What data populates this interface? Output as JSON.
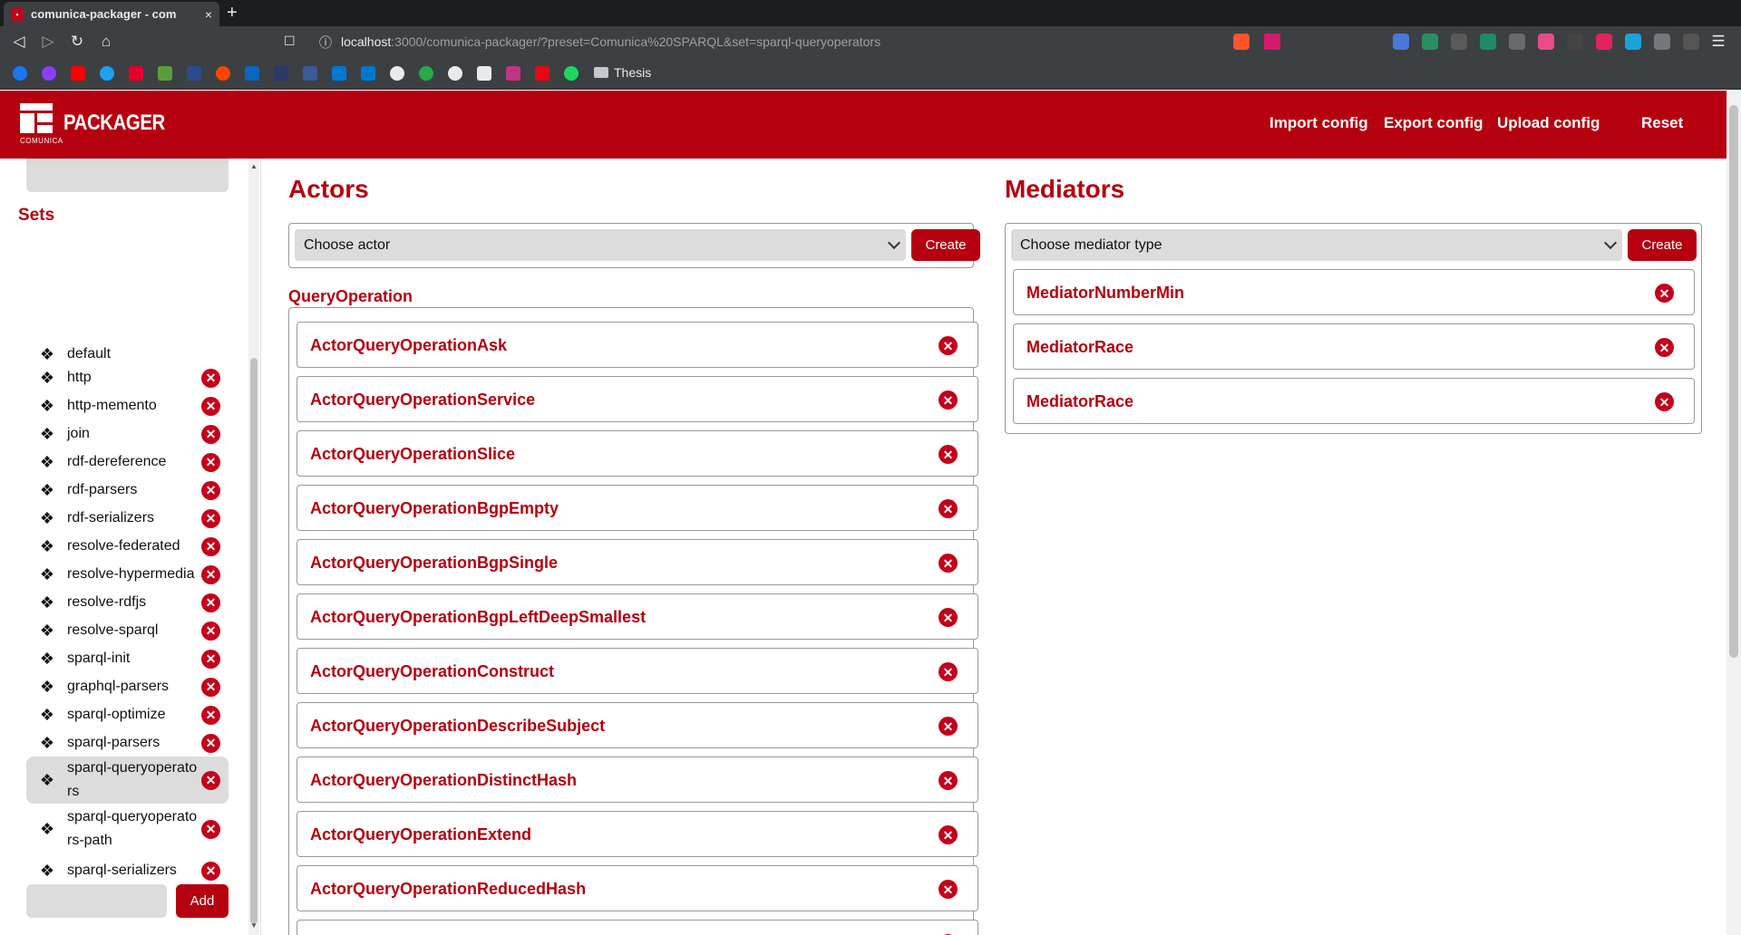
{
  "browser": {
    "tab_title": "comunica-packager - com",
    "tab_close": "×",
    "new_tab": "+",
    "url_host": "localhost",
    "url_rest": ":3000/comunica-packager/?preset=Comunica%20SPARQL&set=sparql-queryoperators",
    "bookmark_folder": "Thesis",
    "nav": {
      "back": "◁",
      "forward": "▷",
      "reload": "↻",
      "home": "⌂",
      "bookmark": "☐",
      "info": "ⓘ",
      "menu": "☰"
    }
  },
  "header": {
    "brand": "PACKAGER",
    "brand_small": "COMUNICA",
    "links": [
      "Import config",
      "Export config",
      "Upload config",
      "Reset"
    ]
  },
  "sidebar": {
    "title": "Sets",
    "add_label": "Add",
    "remove_glyph": "✕",
    "set_icon": "❖",
    "items": [
      {
        "label": "default",
        "removable": false,
        "active": false
      },
      {
        "label": "http",
        "removable": true,
        "active": false
      },
      {
        "label": "http-memento",
        "removable": true,
        "active": false
      },
      {
        "label": "join",
        "removable": true,
        "active": false
      },
      {
        "label": "rdf-dereference",
        "removable": true,
        "active": false
      },
      {
        "label": "rdf-parsers",
        "removable": true,
        "active": false
      },
      {
        "label": "rdf-serializers",
        "removable": true,
        "active": false
      },
      {
        "label": "resolve-federated",
        "removable": true,
        "active": false
      },
      {
        "label": "resolve-hypermedia",
        "removable": true,
        "active": false
      },
      {
        "label": "resolve-rdfjs",
        "removable": true,
        "active": false
      },
      {
        "label": "resolve-sparql",
        "removable": true,
        "active": false
      },
      {
        "label": "sparql-init",
        "removable": true,
        "active": false
      },
      {
        "label": "graphql-parsers",
        "removable": true,
        "active": false
      },
      {
        "label": "sparql-optimize",
        "removable": true,
        "active": false
      },
      {
        "label": "sparql-parsers",
        "removable": true,
        "active": false
      },
      {
        "label": "sparql-queryoperators",
        "removable": true,
        "active": true
      },
      {
        "label": "sparql-queryoperators-path",
        "removable": true,
        "active": false
      },
      {
        "label": "sparql-serializers",
        "removable": true,
        "active": false
      }
    ]
  },
  "actors": {
    "title": "Actors",
    "select_value": "Choose actor",
    "create_label": "Create",
    "group_title": "QueryOperation",
    "items": [
      "ActorQueryOperationAsk",
      "ActorQueryOperationService",
      "ActorQueryOperationSlice",
      "ActorQueryOperationBgpEmpty",
      "ActorQueryOperationBgpSingle",
      "ActorQueryOperationBgpLeftDeepSmallest",
      "ActorQueryOperationConstruct",
      "ActorQueryOperationDescribeSubject",
      "ActorQueryOperationDistinctHash",
      "ActorQueryOperationExtend",
      "ActorQueryOperationReducedHash",
      ""
    ]
  },
  "mediators": {
    "title": "Mediators",
    "select_value": "Choose mediator type",
    "create_label": "Create",
    "items": [
      "MediatorNumberMin",
      "MediatorRace",
      "MediatorRace"
    ]
  },
  "colors": {
    "accent": "#b5000f",
    "remove": "#c4001a",
    "input_bg": "#dcdcdc"
  }
}
